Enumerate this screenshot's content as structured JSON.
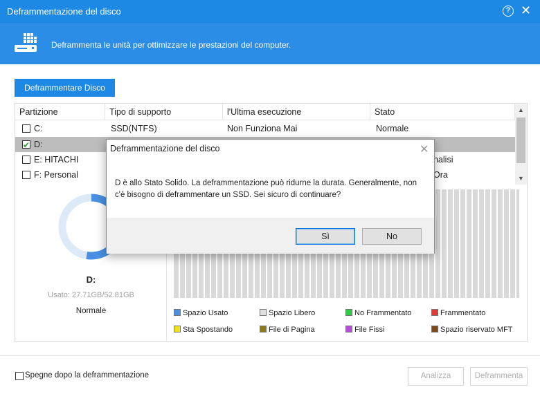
{
  "window": {
    "title": "Deframmentazione del disco",
    "help_glyph": "?",
    "close_glyph": "✕"
  },
  "banner": {
    "description": "Deframmenta le unità per ottimizzare le prestazioni del computer."
  },
  "toolbar": {
    "defrag_disk_label": "Deframmentare Disco"
  },
  "table": {
    "columns": [
      "Partizione",
      "Tipo di supporto",
      "l'Ultima esecuzione",
      "Stato"
    ],
    "rows": [
      {
        "partition": "C:",
        "type": "SSD(NTFS)",
        "last_run": "Non Funziona Mai",
        "status": "Normale",
        "checked": false,
        "selected": false
      },
      {
        "partition": "D:",
        "type": "",
        "last_run": "",
        "status": "",
        "checked": true,
        "selected": true
      },
      {
        "partition": "E:  HITACHI",
        "type": "",
        "last_run": "",
        "status": "nalisi",
        "checked": false,
        "selected": false
      },
      {
        "partition": "F:  Personal",
        "type": "",
        "last_run": "",
        "status": "Ora",
        "checked": false,
        "selected": false
      }
    ]
  },
  "drive_info": {
    "label": "D:",
    "usage": "Usato: 27.71GB/52.81GB",
    "status": "Normale",
    "used_fraction": 0.525
  },
  "legend": [
    {
      "label": "Spazio Usato",
      "color": "#4a90e2"
    },
    {
      "label": "Spazio Libero",
      "color": "#e0e0e0"
    },
    {
      "label": "No Frammentato",
      "color": "#2ecc40"
    },
    {
      "label": "Frammentato",
      "color": "#e53935"
    },
    {
      "label": "Sta Spostando",
      "color": "#f5e11a"
    },
    {
      "label": "File di Pagina",
      "color": "#8a7a1a"
    },
    {
      "label": "File Fissi",
      "color": "#b84de0"
    },
    {
      "label": "Spazio riservato MFT",
      "color": "#7b4a1a"
    }
  ],
  "footer": {
    "shutdown_label": "Spegne dopo la deframmentazione",
    "analyze_label": "Analizza",
    "defrag_label": "Deframmenta"
  },
  "dialog": {
    "title": "Deframmentazione del disco",
    "close_glyph": "✕",
    "message": "D è allo Stato Solido. La deframmentazione può ridurne la durata. Generalmente, non c'è bisogno di deframmentare un SSD. Sei sicuro di continuare?",
    "yes_label": "Sì",
    "no_label": "No"
  },
  "colors": {
    "accent": "#1e88e5",
    "banner": "#2b8de6",
    "donut_used": "#4a90e2",
    "donut_free": "#dce9f7"
  }
}
